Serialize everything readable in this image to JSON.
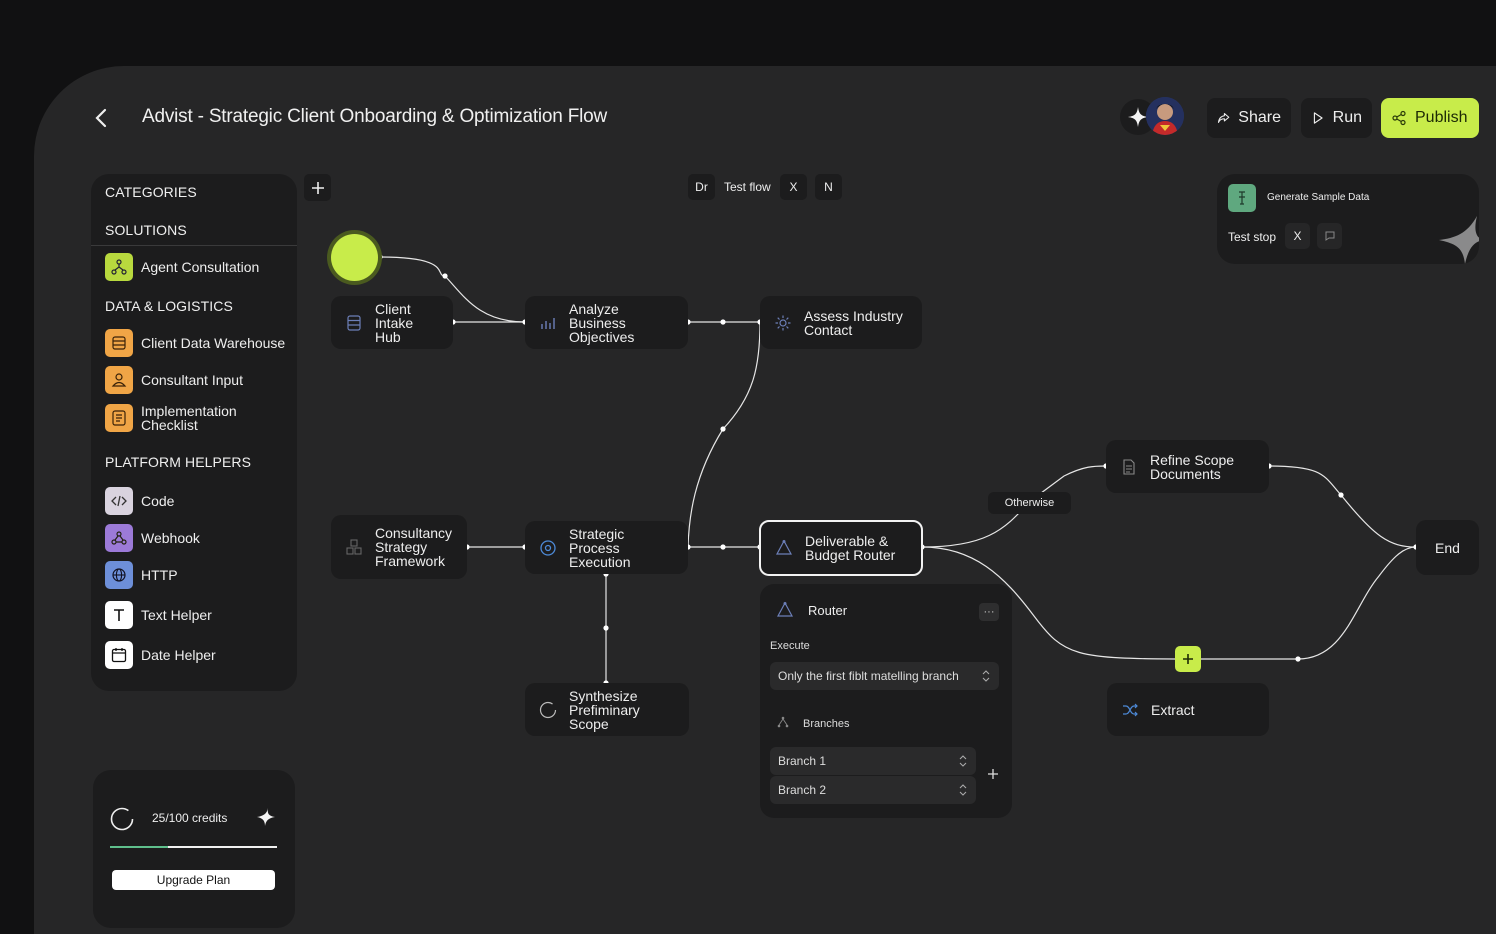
{
  "header": {
    "title": "Advist - Strategic Client Onboarding & Optimization Flow",
    "share_label": "Share",
    "run_label": "Run",
    "publish_label": "Publish"
  },
  "sidebar": {
    "categories_label": "CATEGORIES",
    "solutions_label": "SOLUTIONS",
    "solutions": [
      {
        "label": "Agent Consultation",
        "icon": "agent-icon",
        "color": "#b8d93e"
      }
    ],
    "data_label": "DATA & LOGISTICS",
    "data_items": [
      {
        "label": "Client Data Warehouse",
        "icon": "database-icon",
        "color": "#f0a546"
      },
      {
        "label": "Consultant Input",
        "icon": "user-icon",
        "color": "#f0a546"
      },
      {
        "label": "Implementation Checklist",
        "icon": "checklist-icon",
        "color": "#f0a546"
      }
    ],
    "helpers_label": "PLATFORM HELPERS",
    "helper_items": [
      {
        "label": "Code",
        "icon": "code-icon",
        "color": "#d9d3df"
      },
      {
        "label": "Webhook",
        "icon": "webhook-icon",
        "color": "#9c7ad8"
      },
      {
        "label": "HTTP",
        "icon": "globe-icon",
        "color": "#6d8fd9"
      },
      {
        "label": "Text Helper",
        "icon": "text-icon",
        "color": "#ffffff"
      },
      {
        "label": "Date Helper",
        "icon": "calendar-icon",
        "color": "#ffffff"
      }
    ]
  },
  "credits": {
    "text": "25/100 credits",
    "progress": 0.35,
    "upgrade_label": "Upgrade Plan"
  },
  "toolbar": {
    "dr": "Dr",
    "test_flow": "Test flow",
    "x": "X",
    "n": "N"
  },
  "test_panel": {
    "generate_label": "Generate Sample Data",
    "test_stop": "Test stop",
    "x": "X"
  },
  "nodes": {
    "client_intake": "Client Intake Hub",
    "analyze": "Analyze Business Objectives",
    "assess": "Assess Industry Contact",
    "consultancy": "Consultancy Strategy Framework",
    "strategic": "Strategic Process Execution",
    "deliverable": "Deliverable & Budget Router",
    "synthesize": "Synthesize Prefiminary Scope",
    "refine": "Refine Scope Documents",
    "end": "End",
    "extract": "Extract",
    "otherwise": "Otherwise"
  },
  "router_panel": {
    "title": "Router",
    "execute_label": "Execute",
    "execute_value": "Only the first fiblt matelling branch",
    "branches_label": "Branches",
    "branch_1": "Branch 1",
    "branch_2": "Branch 2"
  },
  "colors": {
    "accent": "#c8ec4a",
    "panel": "#1c1c1d",
    "bg": "#262627"
  }
}
